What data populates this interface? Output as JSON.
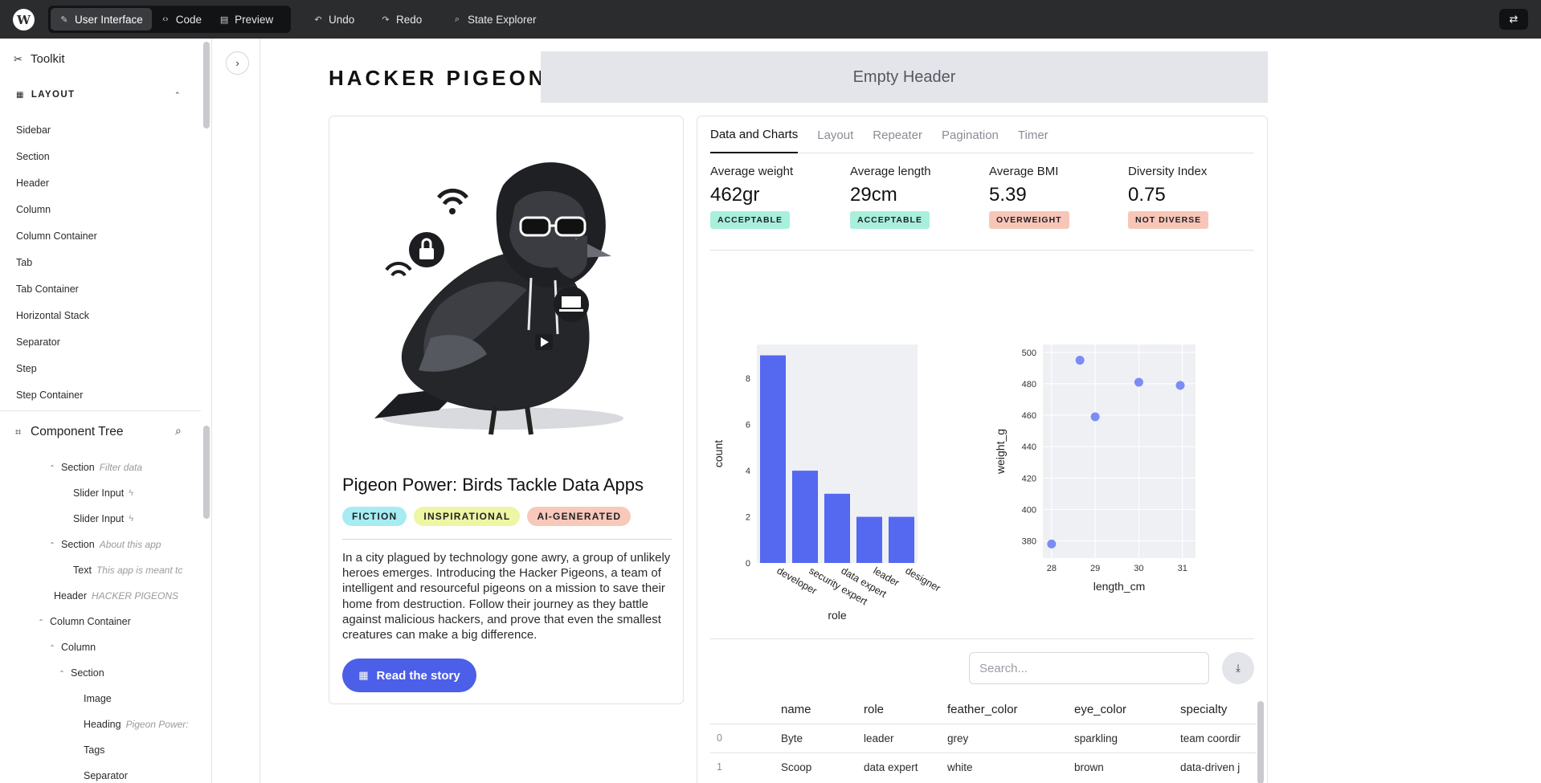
{
  "topbar": {
    "logo": "W",
    "modes": [
      {
        "label": "User Interface",
        "icon": "pencil-icon",
        "active": true
      },
      {
        "label": "Code",
        "icon": "code-icon",
        "active": false
      },
      {
        "label": "Preview",
        "icon": "preview-icon",
        "active": false
      }
    ],
    "undo_label": "Undo",
    "redo_label": "Redo",
    "state_explorer_label": "State Explorer"
  },
  "toolkit": {
    "title": "Toolkit",
    "category": "LAYOUT",
    "items": [
      "Sidebar",
      "Section",
      "Header",
      "Column",
      "Column Container",
      "Tab",
      "Tab Container",
      "Horizontal Stack",
      "Separator",
      "Step",
      "Step Container"
    ]
  },
  "component_tree": {
    "title": "Component Tree",
    "rows": [
      {
        "name": "Section",
        "sub": "Filter data",
        "caret": true
      },
      {
        "name": "Slider Input",
        "sub": "",
        "bolt": true
      },
      {
        "name": "Slider Input",
        "sub": "",
        "bolt": true
      },
      {
        "name": "Section",
        "sub": "About this app",
        "caret": true
      },
      {
        "name": "Text",
        "sub": "This app is meant tc"
      },
      {
        "name": "Header",
        "sub": "HACKER PIGEONS"
      },
      {
        "name": "Column Container",
        "sub": "",
        "caret": true
      },
      {
        "name": "Column",
        "sub": "",
        "caret": true
      },
      {
        "name": "Section",
        "sub": "",
        "caret": true
      },
      {
        "name": "Image",
        "sub": ""
      },
      {
        "name": "Heading",
        "sub": "Pigeon Power:"
      },
      {
        "name": "Tags",
        "sub": ""
      },
      {
        "name": "Separator",
        "sub": ""
      }
    ]
  },
  "app": {
    "title": "HACKER PIGEONS",
    "empty_header": "Empty Header",
    "story": {
      "title": "Pigeon Power: Birds Tackle Data Apps",
      "tags": [
        {
          "label": "FICTION",
          "color": "#a6ecf2"
        },
        {
          "label": "INSPIRATIONAL",
          "color": "#eef5a3"
        },
        {
          "label": "AI-GENERATED",
          "color": "#f8c8ba"
        }
      ],
      "text": "In a city plagued by technology gone awry, a group of unlikely heroes emerges. Introducing the Hacker Pigeons, a team of intelligent and resourceful pigeons on a mission to save their home from destruction. Follow their journey as they battle against malicious hackers, and prove that even the smallest creatures can make a big difference.",
      "button_label": "Read the story"
    },
    "tabs": [
      "Data and Charts",
      "Layout",
      "Repeater",
      "Pagination",
      "Timer"
    ],
    "metrics": [
      {
        "label": "Average weight",
        "value": "462gr",
        "badge": "ACCEPTABLE",
        "badge_color": "#a8f0dc"
      },
      {
        "label": "Average length",
        "value": "29cm",
        "badge": "ACCEPTABLE",
        "badge_color": "#a8f0dc"
      },
      {
        "label": "Average BMI",
        "value": "5.39",
        "badge": "OVERWEIGHT",
        "badge_color": "#f8c6b8"
      },
      {
        "label": "Diversity Index",
        "value": "0.75",
        "badge": "NOT DIVERSE",
        "badge_color": "#f8c6b8"
      }
    ],
    "search_placeholder": "Search...",
    "table": {
      "columns": [
        "",
        "name",
        "role",
        "feather_color",
        "eye_color",
        "specialty"
      ],
      "rows": [
        [
          "0",
          "Byte",
          "leader",
          "grey",
          "sparkling",
          "team coordir"
        ],
        [
          "1",
          "Scoop",
          "data expert",
          "white",
          "brown",
          "data-driven j"
        ]
      ]
    }
  },
  "chart_data": [
    {
      "type": "bar",
      "categories": [
        "developer",
        "security expert",
        "data expert",
        "leader",
        "designer"
      ],
      "values": [
        9,
        4,
        3,
        2,
        2
      ],
      "xlabel": "role",
      "ylabel": "count",
      "ylim": [
        0,
        9.47
      ],
      "yticks": [
        0,
        2,
        4,
        6,
        8
      ],
      "color": "#5468f0"
    },
    {
      "type": "scatter",
      "x": [
        28,
        28.65,
        29,
        30,
        30.95
      ],
      "y": [
        378,
        495,
        459,
        481,
        479
      ],
      "xlabel": "length_cm",
      "ylabel": "weight_g",
      "xlim": [
        27.8,
        31.3
      ],
      "ylim": [
        369,
        505
      ],
      "xticks": [
        28,
        29,
        30,
        31
      ],
      "yticks": [
        380,
        400,
        420,
        440,
        460,
        480,
        500
      ],
      "color": "#7b8cf4"
    }
  ]
}
